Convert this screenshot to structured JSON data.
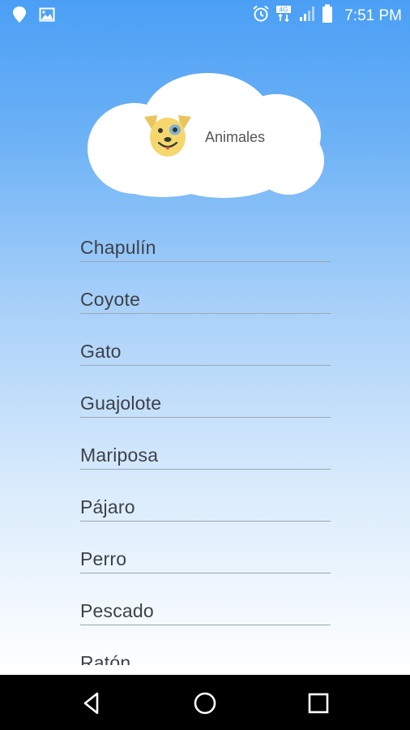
{
  "status_bar": {
    "time": "7:51 PM",
    "network": "4G",
    "icons_left": [
      "location-icon",
      "image-icon"
    ],
    "icons_right": [
      "alarm-icon",
      "network-4g-icon",
      "signal-icon",
      "battery-icon"
    ]
  },
  "header": {
    "title": "Animales",
    "icon": "dog-face-icon"
  },
  "list": {
    "items": [
      {
        "label": "Chapulín"
      },
      {
        "label": "Coyote"
      },
      {
        "label": "Gato"
      },
      {
        "label": "Guajolote"
      },
      {
        "label": "Mariposa"
      },
      {
        "label": "Pájaro"
      },
      {
        "label": "Perro"
      },
      {
        "label": "Pescado"
      },
      {
        "label": "Ratón"
      }
    ]
  },
  "nav": {
    "back": "back-icon",
    "home": "home-icon",
    "recents": "recents-icon"
  },
  "colors": {
    "gradient_top": "#4a9ff5",
    "gradient_bottom": "#ffffff",
    "text": "#3d4148",
    "underline": "#9aa7b5",
    "dog_yellow": "#f5d76e"
  }
}
